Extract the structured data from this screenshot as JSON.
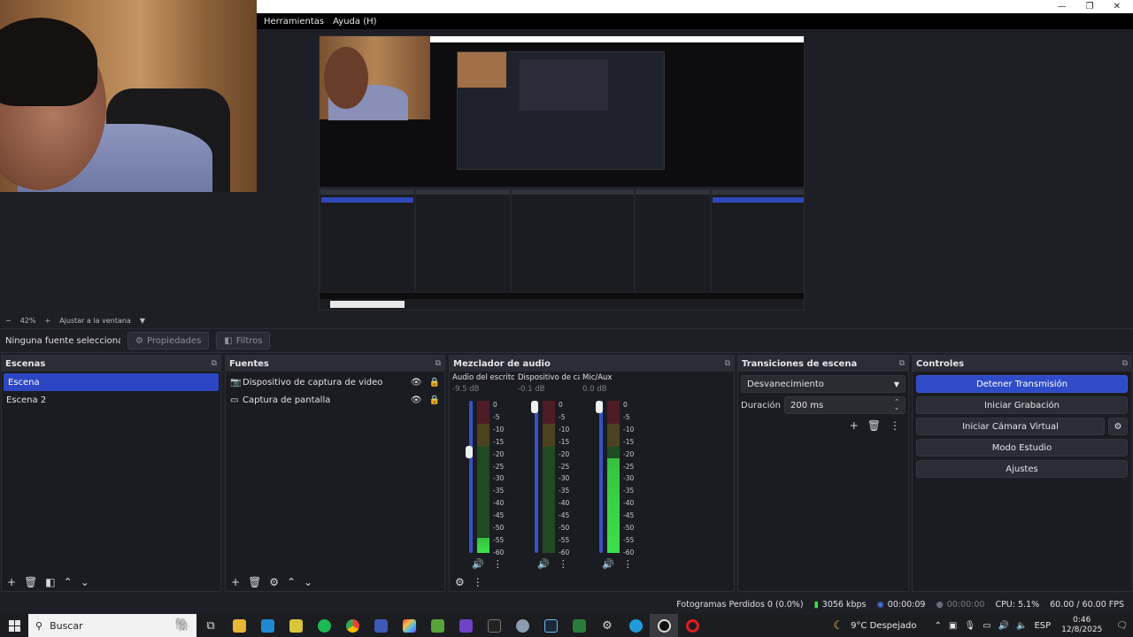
{
  "menu": {
    "items": [
      "Herramientas",
      "Ayuda (H)"
    ]
  },
  "window_controls": {
    "minimize": "—",
    "restore": "❐",
    "close": "✕"
  },
  "preview": {
    "zoom_minus": "−",
    "zoom_level": "42%",
    "zoom_plus": "+",
    "fit_label": "Ajustar a la ventana",
    "fit_caret": "▼"
  },
  "source_toolbar": {
    "no_source": "Ninguna fuente seleccionada",
    "properties": "Propiedades",
    "filters": "Filtros"
  },
  "scenes": {
    "title": "Escenas",
    "items": [
      "Escena",
      "Escena 2"
    ]
  },
  "sources": {
    "title": "Fuentes",
    "items": [
      "Dispositivo de captura de video",
      "Captura de pantalla"
    ]
  },
  "mixer": {
    "title": "Mezclador de audio",
    "scale": [
      "0",
      "-5",
      "-10",
      "-15",
      "-20",
      "-25",
      "-30",
      "-35",
      "-40",
      "-45",
      "-50",
      "-55",
      "-60"
    ],
    "channels": [
      {
        "name": "Audio del escritorio",
        "db": "-9.5 dB",
        "fader": 0.68,
        "level": 0.1
      },
      {
        "name": "Dispositivo de captura",
        "db": "-0.1 dB",
        "fader": 1.0,
        "level": 0.0
      },
      {
        "name": "Mic/Aux",
        "db": "0.0 dB",
        "fader": 1.0,
        "level": 0.62
      }
    ]
  },
  "transitions": {
    "title": "Transiciones de escena",
    "selected": "Desvanecimiento",
    "duration_label": "Duración",
    "duration_value": "200 ms"
  },
  "controls": {
    "title": "Controles",
    "stop_stream": "Detener Transmisión",
    "start_recording": "Iniciar Grabación",
    "start_virtual_cam": "Iniciar Cámara Virtual",
    "studio_mode": "Modo Estudio",
    "settings": "Ajustes"
  },
  "status": {
    "dropped_frames": "Fotogramas Perdidos 0 (0.0%)",
    "bitrate": "3056 kbps",
    "stream_time": "00:00:09",
    "rec_time": "00:00:00",
    "cpu": "CPU: 5.1%",
    "fps": "60.00 / 60.00 FPS"
  },
  "taskbar": {
    "search_placeholder": "Buscar",
    "weather": "9°C Despejado",
    "language": "ESP",
    "time": "0:46",
    "date": "12/8/2025"
  },
  "colors": {
    "accent": "#2e4cc8",
    "meter_green": "#3ee04a",
    "background": "#1e1f26"
  }
}
